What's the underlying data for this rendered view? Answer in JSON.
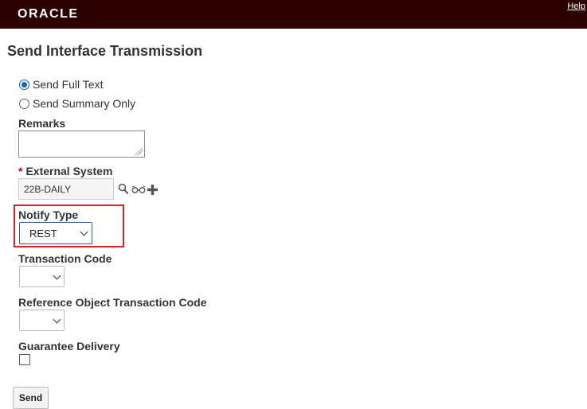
{
  "header": {
    "brand": "ORACLE",
    "help_label": "Help",
    "background": "#2b0000"
  },
  "page": {
    "title": "Send Interface Transmission"
  },
  "form": {
    "send_mode": {
      "options": [
        "Send Full Text",
        "Send Summary Only"
      ],
      "selected": "Send Full Text"
    },
    "remarks": {
      "label": "Remarks",
      "value": ""
    },
    "external_system": {
      "required_marker": "*",
      "label": "External System",
      "value": "22B-DAILY",
      "icons": [
        "search-icon",
        "view-icon",
        "add-icon"
      ]
    },
    "notify_type": {
      "label": "Notify Type",
      "value": "REST",
      "highlight_color": "#e02020"
    },
    "transaction_code": {
      "label": "Transaction Code",
      "value": ""
    },
    "reference_object_transaction_code": {
      "label": "Reference Object Transaction Code",
      "value": ""
    },
    "guarantee_delivery": {
      "label": "Guarantee Delivery",
      "checked": false
    }
  },
  "actions": {
    "send_label": "Send"
  },
  "colors": {
    "accent": "#0b65c4",
    "required": "#cc0000"
  }
}
